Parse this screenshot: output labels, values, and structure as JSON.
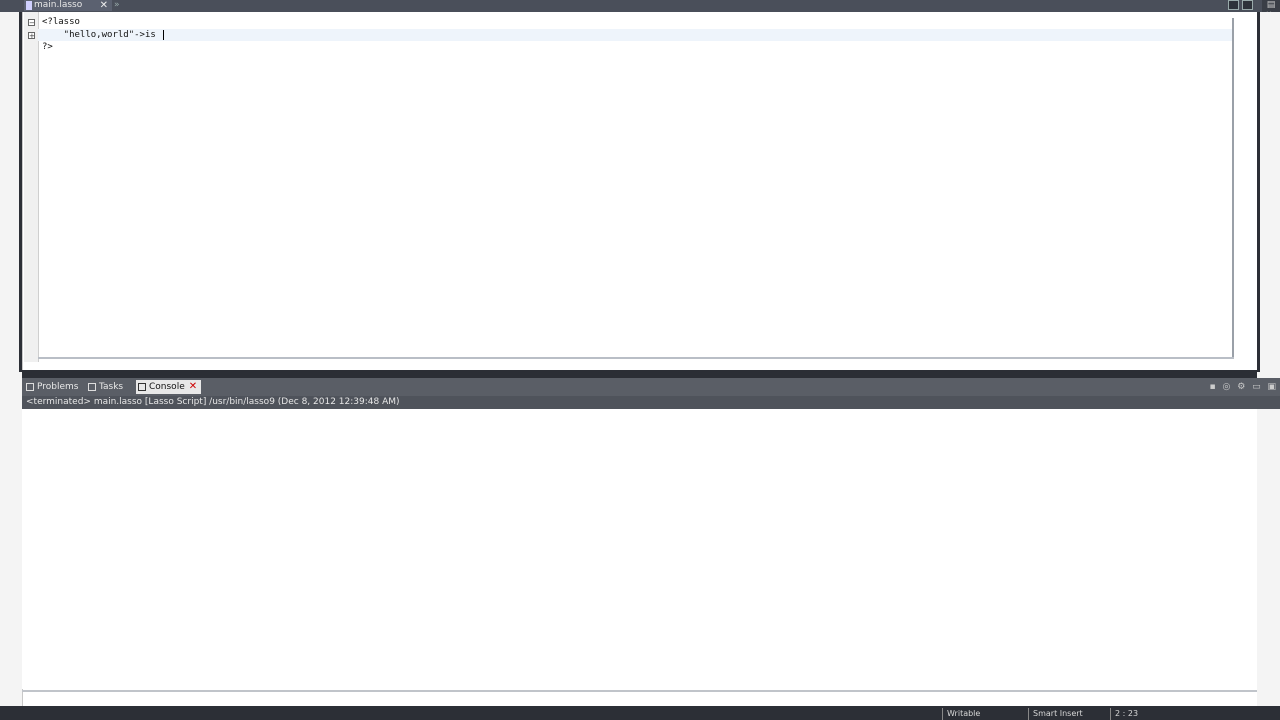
{
  "editor": {
    "tab_label": "main.lasso",
    "tab_close": "✕",
    "tab_more": "»",
    "lines": [
      "<?lasso",
      "    \"hello,world\"->is",
      "?>"
    ]
  },
  "views": {
    "tabs": [
      {
        "label": "Problems"
      },
      {
        "label": "Tasks"
      },
      {
        "label": "Console"
      }
    ],
    "console_close": "✕",
    "console_status": "<terminated> main.lasso [Lasso Script] /usr/bin/lasso9 (Dec 8, 2012 12:39:48 AM)"
  },
  "statusbar": {
    "items": [
      "Writable",
      "Smart Insert",
      "2 : 23"
    ]
  },
  "colors": {
    "chrome_dark": "#2c2f36",
    "tab_bar": "#5a5e66",
    "current_line": "#eef4fb"
  }
}
